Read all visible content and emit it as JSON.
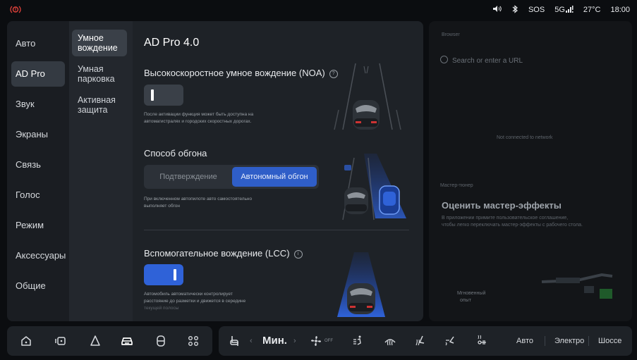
{
  "status": {
    "alert_icon": "car-alert-icon",
    "volume_icon": "volume-icon",
    "bluetooth_icon": "bluetooth-icon",
    "sos": "SOS",
    "network": "5G",
    "temperature": "27°C",
    "time": "18:00"
  },
  "nav_primary": [
    {
      "label": "Авто"
    },
    {
      "label": "AD Pro",
      "active": true
    },
    {
      "label": "Звук"
    },
    {
      "label": "Экраны"
    },
    {
      "label": "Связь"
    },
    {
      "label": "Голос"
    },
    {
      "label": "Режим"
    },
    {
      "label": "Аксессуары"
    },
    {
      "label": "Общие"
    }
  ],
  "nav_secondary": [
    {
      "line1": "Умное",
      "line2": "вождение",
      "active": true
    },
    {
      "line1": "Умная",
      "line2": "парковка"
    },
    {
      "line1": "Активная",
      "line2": "защита"
    }
  ],
  "content": {
    "title": "AD Pro 4.0",
    "noa": {
      "title": "Высокоскоростное умное вождение (NOA)",
      "toggle_on": false,
      "desc1": "После активации функция может быть доступна на",
      "desc2": "автомагистралях и городских скоростных дорогах."
    },
    "overtake": {
      "title": "Способ обгона",
      "options": [
        "Подтверждение",
        "Автономный обгон"
      ],
      "selected": 1,
      "desc1": "При включенном автопилоте авто самостоятельно",
      "desc2": "выполняет обгон"
    },
    "lcc": {
      "title": "Вспомогательное вождение (LCC)",
      "toggle_on": true,
      "desc1": "Автомобиль автоматически контролирует",
      "desc2": "расстояние до разметки и движется в середине",
      "desc3": "текущей полосы"
    }
  },
  "right_panel": {
    "browser_label": "Browser",
    "search_placeholder": "Search or enter a URL",
    "center_text": "Not connected to network",
    "tuner_label": "Мастер-тюнер",
    "heading": "Оценить мастер-эффекты",
    "sub1": "В приложении примите пользовательское соглашение,",
    "sub2": "чтобы легко переключать мастер-эффекты с рабочего стола.",
    "instant1": "Мгновенный",
    "instant2": "опыт"
  },
  "dock": {
    "left_icons": [
      "home-icon",
      "multiscreen-icon",
      "navigation-icon",
      "car-icon",
      "phone-icon",
      "apps-icon"
    ],
    "temp_level": "Мин.",
    "fan_state": "OFF",
    "modes": [
      "Авто",
      "Электро",
      "Шоссе"
    ]
  },
  "colors": {
    "accent": "#2f62d8",
    "panel": "#1e2227",
    "background": "#0b0d10",
    "alert": "#e0413a"
  }
}
